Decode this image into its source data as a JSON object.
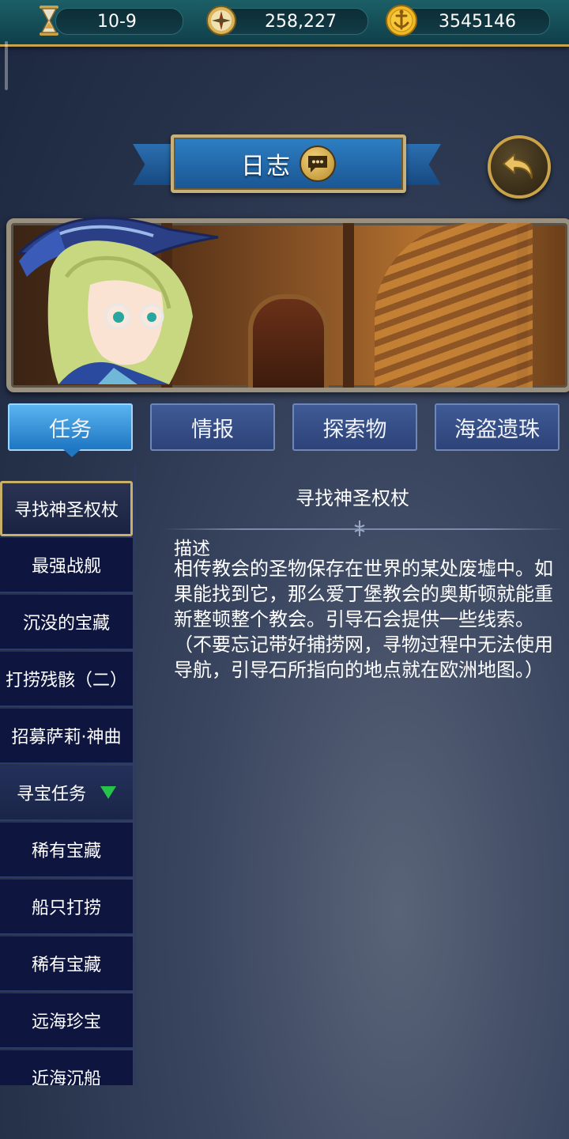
{
  "topbar": {
    "level": "10-9",
    "compass_value": "258,227",
    "coin_value": "3545146",
    "icons": [
      "hourglass-icon",
      "compass-icon",
      "anchor-coin-icon"
    ]
  },
  "header": {
    "title": "日志",
    "chat_icon": "chat-bubble-icon",
    "back_icon": "back-arrow-icon"
  },
  "tabs": [
    {
      "label": "任务",
      "active": true
    },
    {
      "label": "情报",
      "active": false
    },
    {
      "label": "探索物",
      "active": false
    },
    {
      "label": "海盗遗珠",
      "active": false
    }
  ],
  "quest_list": [
    {
      "label": "寻找神圣权杖",
      "selected": true
    },
    {
      "label": "最强战舰"
    },
    {
      "label": "沉没的宝藏"
    },
    {
      "label": "打捞残骸（二）"
    },
    {
      "label": "招募萨莉·神曲"
    },
    {
      "label": "寻宝任务",
      "group": true
    },
    {
      "label": "稀有宝藏"
    },
    {
      "label": "船只打捞"
    },
    {
      "label": "稀有宝藏"
    },
    {
      "label": "远海珍宝"
    },
    {
      "label": "近海沉船"
    }
  ],
  "detail": {
    "title": "寻找神圣权杖",
    "label": "描述",
    "description": "相传教会的圣物保存在世界的某处废墟中。如果能找到它，那么爱丁堡教会的奥斯顿就能重新整顿整个教会。引导石会提供一些线索。（不要忘记带好捕捞网，寻物过程中无法使用导航，引导石所指向的地点就在欧洲地图。）"
  },
  "colors": {
    "accent_gold": "#c9a24a",
    "tab_active": "#1f76c2",
    "tab_inactive": "#2d4378",
    "list_bg": "#0e1640",
    "group_arrow": "#27c24a"
  }
}
